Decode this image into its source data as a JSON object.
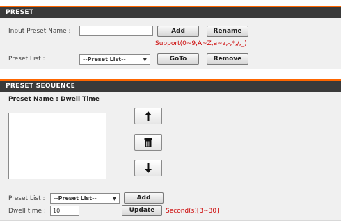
{
  "preset": {
    "header": "PRESET",
    "input_label": "Input Preset Name :",
    "input_value": "",
    "add_button": "Add",
    "rename_button": "Rename",
    "support_hint": "Support(0~9,A~Z,a~z,-,*,/,_)",
    "list_label": "Preset List :",
    "list_selected": "--Preset List--",
    "goto_button": "GoTo",
    "remove_button": "Remove"
  },
  "sequence": {
    "header": "PRESET SEQUENCE",
    "columns_label": "Preset Name : Dwell Time",
    "list_label": "Preset List :",
    "list_selected": "--Preset List--",
    "add_button": "Add",
    "dwell_label": "Dwell time :",
    "dwell_value": "10",
    "update_button": "Update",
    "dwell_hint": "Second(s)[3~30]"
  },
  "icons": {
    "up": "arrow-up-icon",
    "delete": "trash-icon",
    "down": "arrow-down-icon",
    "dropdown": "chevron-down-icon"
  },
  "colors": {
    "header_bg": "#3a3a3a",
    "header_accent": "#ff6600",
    "hint_red": "#cc0000",
    "panel_bg": "#f0f0f0"
  }
}
